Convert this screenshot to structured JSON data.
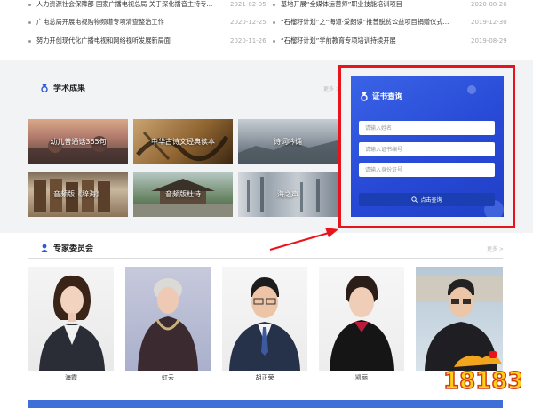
{
  "news": {
    "left": [
      {
        "title": "人力资源社会保障部 国家广播电视总局 关于深化播音主持专...",
        "date": "2021-02-05"
      },
      {
        "title": "广电总局开展电视购物频道专项清查整治工作",
        "date": "2020-12-25"
      },
      {
        "title": "努力开创现代化广播电视和网络视听发展新局面",
        "date": "2020-11-26"
      }
    ],
    "right": [
      {
        "title": "基地开展“全媒体运营师”职业技能培训项目",
        "date": "2020-08-26"
      },
      {
        "title": "“石榴籽计划”之“海道·爱朗读”推普脱贫公益项目捐赠仪式...",
        "date": "2019-12-30"
      },
      {
        "title": "“石榴籽计划”学前教育专项培训持续开展",
        "date": "2019-08-29"
      }
    ]
  },
  "academic": {
    "title": "学术成果",
    "more": "更多 >",
    "tiles": [
      {
        "label": "幼儿普通话365句"
      },
      {
        "label": "中华古诗文经典读本"
      },
      {
        "label": "诗词吟诵"
      },
      {
        "label": "音频版《辞海》"
      },
      {
        "label": "音频版杜诗"
      },
      {
        "label": "海之声"
      }
    ]
  },
  "certificate": {
    "title": "证书查询",
    "name_placeholder": "请输入姓名",
    "cert_placeholder": "请输入证书编号",
    "id_placeholder": "请输入身份证号",
    "button": "点击查询"
  },
  "experts": {
    "title": "专家委员会",
    "more": "更多 >",
    "members": [
      {
        "name": "海霞"
      },
      {
        "name": "虹云"
      },
      {
        "name": "胡正荣"
      },
      {
        "name": "凯丽"
      },
      {
        "name": ""
      }
    ]
  },
  "watermark": "18183",
  "colors": {
    "accent_blue": "#2749d6",
    "highlight_red": "#e8131b"
  }
}
